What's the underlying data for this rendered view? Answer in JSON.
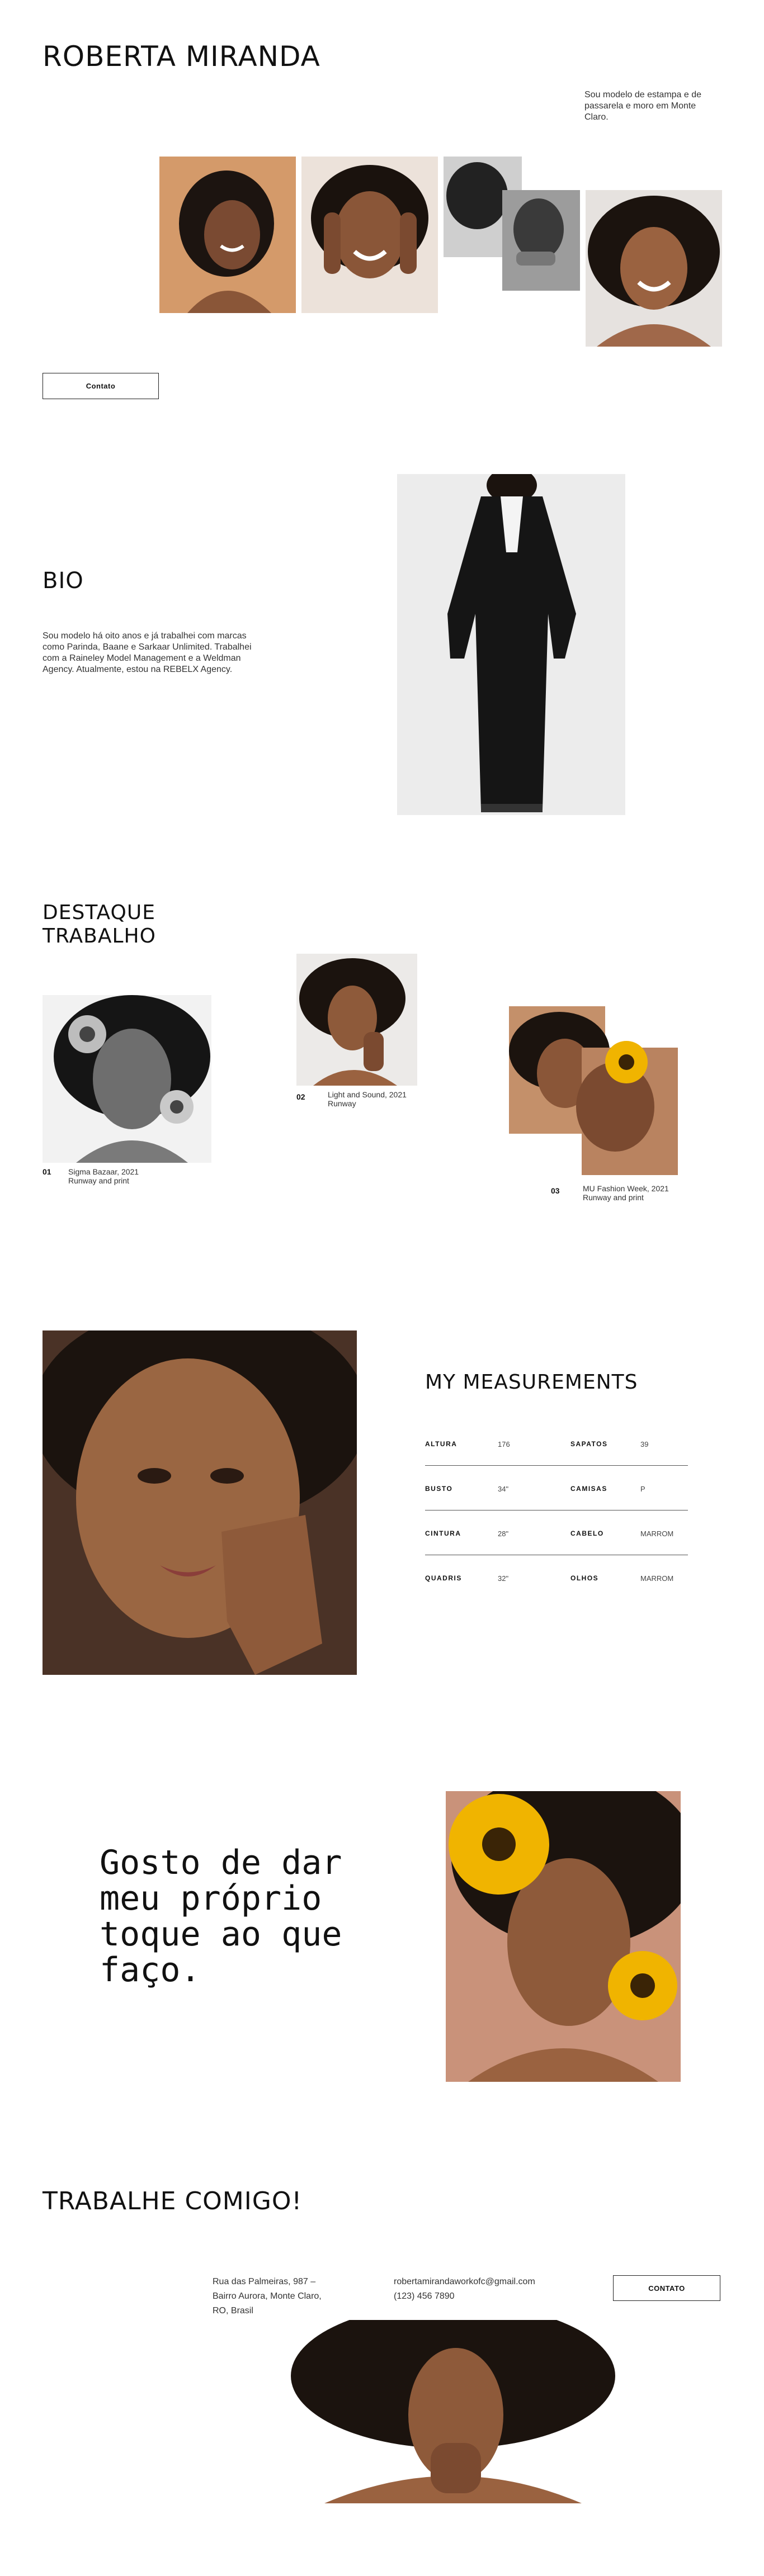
{
  "header": {
    "name": "ROBERTA MIRANDA",
    "intro": "Sou modelo de estampa e de passarela e moro em Monte Claro.",
    "contact_button": "Contato"
  },
  "bio": {
    "title": "BIO",
    "text": "Sou modelo há oito anos e já trabalhei com marcas como Parinda, Baane e Sarkaar Unlimited. Trabalhei com a Raineley Model Management e a Weldman Agency. Atualmente, estou na REBELX Agency."
  },
  "featured": {
    "title_line1": "DESTAQUE",
    "title_line2": "TRABALHO",
    "items": [
      {
        "num": "01",
        "line1": "Sigma Bazaar, 2021",
        "line2": "Runway and print"
      },
      {
        "num": "02",
        "line1": "Light and Sound, 2021",
        "line2": "Runway"
      },
      {
        "num": "03",
        "line1": "MU Fashion Week, 2021",
        "line2": "Runway and print"
      }
    ]
  },
  "measurements": {
    "title": "MY MEASUREMENTS",
    "rows": [
      {
        "l1": "ALTURA",
        "v1": "176",
        "l2": "SAPATOS",
        "v2": "39"
      },
      {
        "l1": "BUSTO",
        "v1": "34\"",
        "l2": "CAMISAS",
        "v2": "P"
      },
      {
        "l1": "CINTURA",
        "v1": "28\"",
        "l2": "CABELO",
        "v2": "MARROM"
      },
      {
        "l1": "QUADRIS",
        "v1": "32\"",
        "l2": "OLHOS",
        "v2": "MARROM"
      }
    ]
  },
  "quote": {
    "line1": "Gosto de dar",
    "line2": "meu próprio",
    "line3": "toque ao que",
    "line4": "faço."
  },
  "contact": {
    "title": "TRABALHE COMIGO!",
    "address_line1": "Rua das Palmeiras, 987 –",
    "address_line2": "Bairro Aurora, Monte Claro,",
    "address_line3": "RO, Brasil",
    "email": "robertamirandaworkofc@gmail.com",
    "phone": "(123) 456 7890",
    "button": "CONTATO"
  },
  "colors": {
    "accent_skin_bg": "#d09a6c",
    "sunflower": "#f0b400",
    "text": "#111111"
  }
}
